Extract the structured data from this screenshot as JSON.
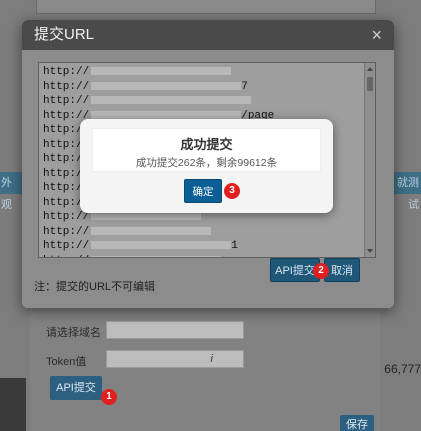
{
  "background": {
    "left_strip_text": "外观",
    "right_strip_text": "就测试",
    "domain_label": "请选择域名",
    "domain_value": "",
    "token_label": "Token值",
    "token_value": "i",
    "api_submit_label": "API提交",
    "save_label": "保存",
    "number_text": "66,777"
  },
  "dialog": {
    "title": "提交URL",
    "close_symbol": "×",
    "url_prefix": "http://",
    "url_line_suffixes": [
      "",
      "7",
      "",
      "/page",
      "",
      "",
      "",
      "",
      "",
      "",
      "",
      "",
      "1",
      ""
    ],
    "note": "注：提交的URL不可编辑",
    "api_submit_label": "API提交",
    "cancel_label": "取消"
  },
  "popup": {
    "title": "成功提交",
    "message": "成功提交262条，剩余99612条",
    "ok_label": "确定"
  },
  "badges": {
    "one": "1",
    "two": "2",
    "three": "3"
  },
  "colors": {
    "primary_button": "#1f5779",
    "badge": "#e02020",
    "ok_button": "#0b5f95"
  }
}
